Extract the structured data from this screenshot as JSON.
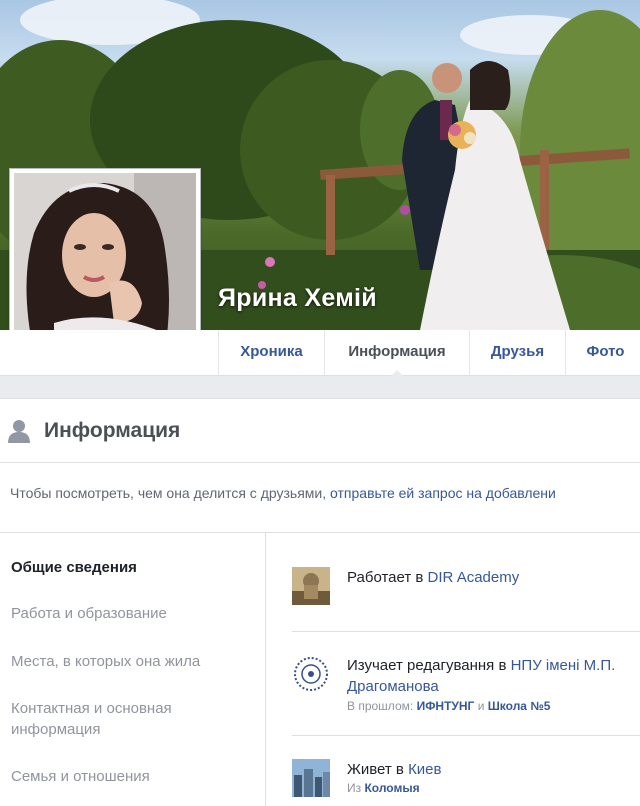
{
  "profile": {
    "name": "Ярина Хемій"
  },
  "nav": {
    "tabs": [
      {
        "label": "Хроника"
      },
      {
        "label": "Информация"
      },
      {
        "label": "Друзья"
      },
      {
        "label": "Фото"
      }
    ],
    "active": "Информация"
  },
  "info": {
    "title": "Информация",
    "notice_text": "Чтобы посмотреть, чем она делится с друзьями,",
    "notice_link": "отправьте ей запрос на добавлени"
  },
  "sidebar": {
    "items": [
      {
        "label": "Общие сведения"
      },
      {
        "label": "Работа и образование"
      },
      {
        "label": "Места, в которых она жила"
      },
      {
        "label": "Контактная и основная информация"
      },
      {
        "label": "Семья и отношения"
      }
    ]
  },
  "entries": {
    "work": {
      "prefix": "Работает в",
      "link": "DIR Academy"
    },
    "study": {
      "prefix": "Изучает редагування в",
      "link": "НПУ імені М.П. Драгоманова",
      "past_label": "В прошлом:",
      "past_1": "ИФНТУНГ",
      "past_and": "и",
      "past_2": "Школа №5"
    },
    "lives": {
      "prefix": "Живет в",
      "link": "Киев",
      "from_label": "Из",
      "from_link": "Коломыя"
    }
  },
  "colors": {
    "link": "#365899",
    "muted": "#90949c",
    "background": "#e9ebee"
  },
  "icons": {
    "header": "person-icon",
    "work": "work-photo-icon",
    "study": "university-seal-icon",
    "lives": "city-photo-icon"
  }
}
